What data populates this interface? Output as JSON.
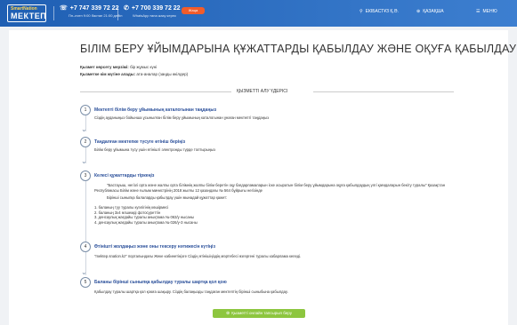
{
  "topbar": {
    "logo_top": "SmartNation",
    "logo_main": "МЕКТЕП",
    "phone1": "+7 747 339 72 22",
    "phone1_sub": "Пн–пятн 9:00 бастап 21:00 дейін",
    "phone2": "+7 700 339 72 22",
    "phone2_sub": "WhatsApp ғана жазу керек",
    "badge": "Жаңа",
    "user": "ЕКІБАСТҰЗ Қ.Ә.",
    "lang": "ҚАЗАҚША",
    "menu": "МЕНЮ"
  },
  "page": {
    "title": "БІЛІМ БЕРУ ҰЙЫМДАРЫНА ҚҰЖАТТАРДЫ ҚАБЫЛДАУ ЖӘНЕ ОҚУҒА ҚАБЫЛДАУ",
    "meta1_label": "Қызмет көрсету мерзімі:",
    "meta1_value": "бір жұмыс күні",
    "meta2_label": "Қызметке кім жүгіне алады:",
    "meta2_value": "ата-аналар (заңды өкілдер)",
    "section": "ҚЫЗМЕТТІ АЛУ ҮДЕРІСІ",
    "steps": [
      {
        "n": "1",
        "title": "Мектепті білім беру ұйымының каталогынан таңдаңыз",
        "text": "Сіздің ауданыңыз бойынша ұсынылған білім беру ұйымының каталогынан ұнаған мектепті таңдаңыз"
      },
      {
        "n": "2",
        "title": "Таңдалған мектепке түсуге өтініш беріңіз",
        "text": "Білім беру ұйымына түсу үшін өтінішті электронды түрде толтырыңыз"
      },
      {
        "n": "3",
        "title": "Келесі құжаттарды тіркеңіз",
        "text": "\"Бастауыш, негізгі орта және жалпы орта білімнің жалпы білім беретін оқу бағдарламаларын іске асыратын білім беру ұйымдарына оқуға қабылдаудың үлгі қағидаларын бекіту туралы\" Қазақстан Республикасы Білім және ғылым министрінің 2018 жылғы 12 қазандағы № 564 бұйрығы негізінде",
        "text2": "Бірінші сыныпқа балаларды қабылдау үшін мынадай құжаттар қажет:"
      },
      {
        "n": "4",
        "title": "Өтінішті жолдаңыз және оны тексеру нәтижесін күтіңіз",
        "text": "\"mektep.snation.kz\" порталындағы Жеке кабинетіңізге Сіздің өтінішіңіздің мәртебесі өзгергені туралы хабарлама келеді."
      },
      {
        "n": "5",
        "title": "Баланы бірінші сыныпқа қабылдау туралы шартқа қол қою",
        "text": "Қабылдау туралы шартқа қол қоюға шақыру. Сіздің балаңызды таңдаған мектептің бірінші сыныбына қабылдау."
      }
    ],
    "docs": [
      "1. баланың туу туралы куәлігінің көшірмесі",
      "2. баланың 3х4 өлшемді фотосуреттін",
      "3. денсаулық жағдайы туралы анықтама № 063/у нысаны",
      "4. денсаулық жағдайы туралы анықтама № 026/у-3 нысаны"
    ],
    "cta": "Қызметті онлайн тапсырып беру"
  },
  "colors": {
    "topbar": "#1f5fb3",
    "accent": "#2a4f9a",
    "cta": "#8dc63f",
    "badge": "#f25c2a"
  },
  "icons": [
    "phone-icon",
    "whatsapp-icon",
    "location-icon",
    "globe-icon",
    "menu-icon",
    "check-icon",
    "chevron-down-icon"
  ]
}
